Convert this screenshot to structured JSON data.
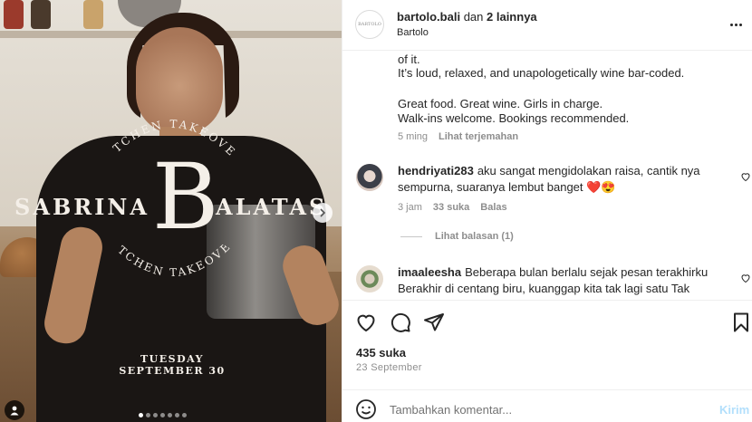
{
  "media": {
    "overlay": {
      "name_left": "SABRINA",
      "name_right": "ALATAS",
      "monogram": "B",
      "arc_top": "KITCHEN TAKEOVER",
      "arc_bottom": "KITCHEN TAKEOVER",
      "date_line1": "TUESDAY",
      "date_line2": "SEPTEMBER 30"
    },
    "carousel": {
      "count": 7,
      "active_index": 0
    }
  },
  "header": {
    "author": "bartolo.bali",
    "separator": "dan",
    "collab": "2 lainnya",
    "location": "Bartolo"
  },
  "caption": {
    "lines": [
      "of it.",
      "It’s loud, relaxed, and unapologetically wine bar-coded.",
      "",
      "Great food. Great wine. Girls in charge.",
      "Walk-ins welcome. Bookings recommended."
    ],
    "time": "5 ming",
    "translate": "Lihat terjemahan"
  },
  "comments": [
    {
      "username": "hendriyati283",
      "text": "aku sangat mengidolakan raisa, cantik nya sempurna, suaranya lembut banget ❤️😍",
      "time": "3 jam",
      "likes": "33 suka",
      "reply": "Balas",
      "view_replies": "Lihat balasan (1)"
    },
    {
      "username": "imaaleesha",
      "text": "Beberapa bulan berlalu sejak pesan terakhirku Berakhir di centang biru, kuanggap kita tak lagi satu Tak mengapa ku tak terbalas tapi"
    }
  ],
  "likes": "435 suka",
  "post_date": "23 September",
  "comment_box": {
    "placeholder": "Tambahkan komentar...",
    "post_label": "Kirim"
  },
  "icons": {
    "like": "heart-icon",
    "comment": "comment-icon",
    "share": "send-icon",
    "save": "bookmark-icon",
    "emoji": "emoji-icon",
    "more": "more-horizontal-icon",
    "next": "chevron-right-icon",
    "tag": "user-tag-icon"
  },
  "colors": {
    "post_button": "#b2dffc",
    "secondary_text": "#8e8e8e"
  }
}
